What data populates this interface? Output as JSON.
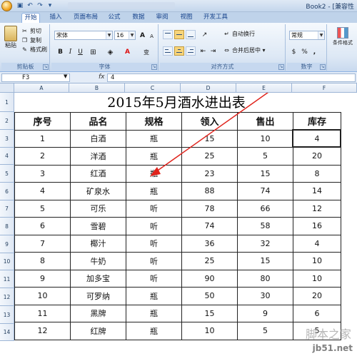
{
  "window": {
    "doc_title": "Book2 - [兼容性"
  },
  "ribbon": {
    "tabs": [
      {
        "label": "开始",
        "active": true
      },
      {
        "label": "插入"
      },
      {
        "label": "页面布局"
      },
      {
        "label": "公式"
      },
      {
        "label": "数据"
      },
      {
        "label": "审阅"
      },
      {
        "label": "视图"
      },
      {
        "label": "开发工具"
      }
    ],
    "clipboard": {
      "paste": "粘贴",
      "cut": "剪切",
      "copy": "复制",
      "format_painter": "格式刷",
      "group": "剪贴板"
    },
    "font": {
      "font_name": "宋体",
      "font_size": "16",
      "bold": "B",
      "italic": "I",
      "underline": "U",
      "grow": "A",
      "shrink": "A",
      "font_color_letter": "A",
      "wen": "变",
      "group": "字体"
    },
    "alignment": {
      "wrap_text": "自动换行",
      "merge_center": "合并后居中",
      "group": "对齐方式"
    },
    "number": {
      "format": "常规",
      "percent": "%",
      "comma": ",",
      "group": "数字"
    },
    "styles": {
      "conditional": "条件格式"
    }
  },
  "formula_bar": {
    "name_box": "F3",
    "fx": "fx",
    "value": "4"
  },
  "sheet": {
    "columns": [
      "A",
      "B",
      "C",
      "D",
      "E",
      "F"
    ],
    "rows": [
      "1",
      "2",
      "3",
      "4",
      "5",
      "6",
      "7",
      "8",
      "9",
      "10",
      "11",
      "12",
      "13",
      "14"
    ],
    "title": "2015年5月酒水进出表",
    "headers": [
      "序号",
      "品名",
      "规格",
      "领入",
      "售出",
      "库存"
    ],
    "data": [
      [
        "1",
        "白酒",
        "瓶",
        "15",
        "10",
        "4"
      ],
      [
        "2",
        "洋酒",
        "瓶",
        "25",
        "5",
        "20"
      ],
      [
        "3",
        "红酒",
        "瓶",
        "23",
        "15",
        "8"
      ],
      [
        "4",
        "矿泉水",
        "瓶",
        "88",
        "74",
        "14"
      ],
      [
        "5",
        "可乐",
        "听",
        "78",
        "66",
        "12"
      ],
      [
        "6",
        "雪碧",
        "听",
        "74",
        "58",
        "16"
      ],
      [
        "7",
        "椰汁",
        "听",
        "36",
        "32",
        "4"
      ],
      [
        "8",
        "牛奶",
        "听",
        "25",
        "15",
        "10"
      ],
      [
        "9",
        "加多宝",
        "听",
        "90",
        "80",
        "10"
      ],
      [
        "10",
        "可罗纳",
        "瓶",
        "50",
        "30",
        "20"
      ],
      [
        "11",
        "黑牌",
        "瓶",
        "15",
        "9",
        "6"
      ],
      [
        "12",
        "红牌",
        "瓶",
        "10",
        "5",
        "5"
      ]
    ]
  },
  "watermark": {
    "main": "脚本之家",
    "sub": "jb51.net"
  },
  "colors": {
    "ribbon_blue": "#15428b",
    "annotation_arrow": "#e0231c"
  }
}
